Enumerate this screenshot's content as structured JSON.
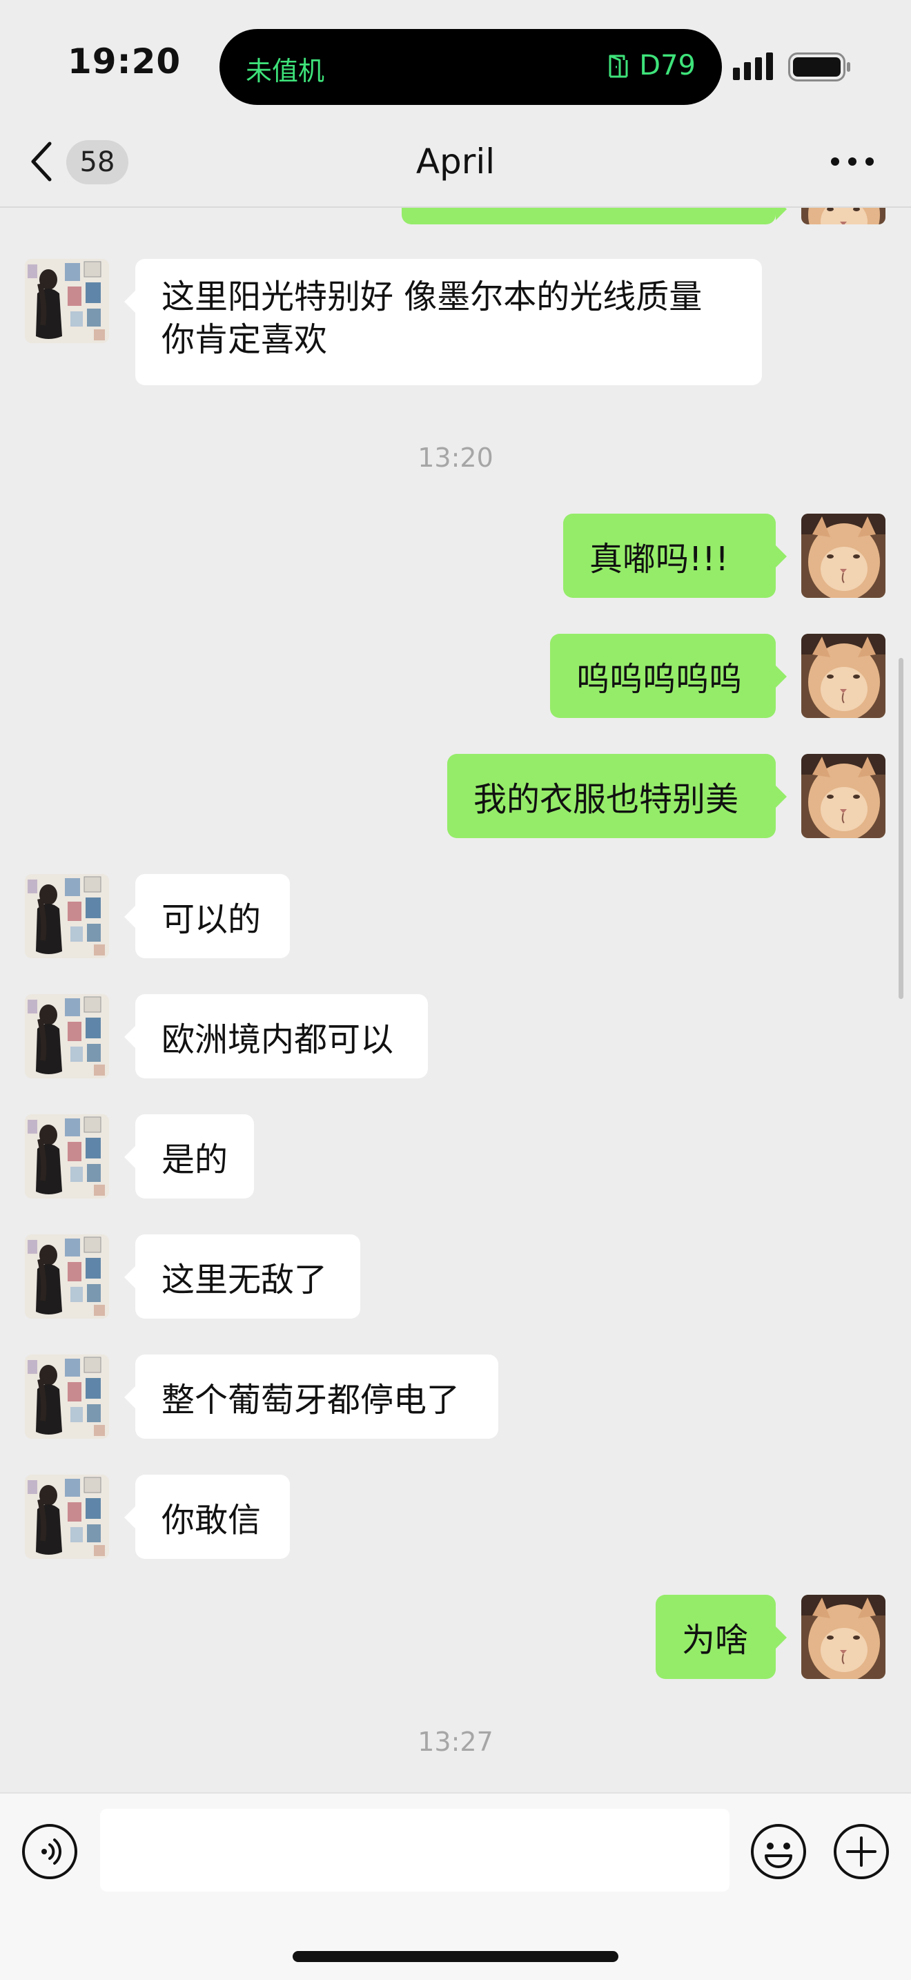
{
  "status_bar": {
    "time": "19:20",
    "island_left": "未值机",
    "island_right": "D79",
    "island_icon": "gate-icon",
    "signal_icon": "cellular-signal-icon",
    "battery_icon": "battery-icon"
  },
  "nav": {
    "back_icon": "chevron-left-icon",
    "unread_count": "58",
    "title": "April",
    "more_icon": "more-dots-icon"
  },
  "timestamps": [
    "13:20",
    "13:27"
  ],
  "messages": [
    {
      "sender": "other",
      "text_lines": [
        "这里阳光特别好 像墨尔本的光线质量",
        "你肯定喜欢"
      ]
    },
    {
      "sender": "me",
      "text": "真嘟吗!!!"
    },
    {
      "sender": "me",
      "text": "呜呜呜呜呜"
    },
    {
      "sender": "me",
      "text": "我的衣服也特别美"
    },
    {
      "sender": "other",
      "text": "可以的"
    },
    {
      "sender": "other",
      "text": "欧洲境内都可以"
    },
    {
      "sender": "other",
      "text": "是的"
    },
    {
      "sender": "other",
      "text": "这里无敌了"
    },
    {
      "sender": "other",
      "text": "整个葡萄牙都停电了"
    },
    {
      "sender": "other",
      "text": "你敢信"
    },
    {
      "sender": "me",
      "text": "为啥"
    }
  ],
  "input_bar": {
    "voice_icon": "voice-input-icon",
    "emoji_icon": "emoji-icon",
    "plus_icon": "plus-icon",
    "value": ""
  },
  "colors": {
    "background": "#ededed",
    "bubble_me": "#95ec69",
    "bubble_other": "#ffffff",
    "island_text": "#3ee37a"
  }
}
